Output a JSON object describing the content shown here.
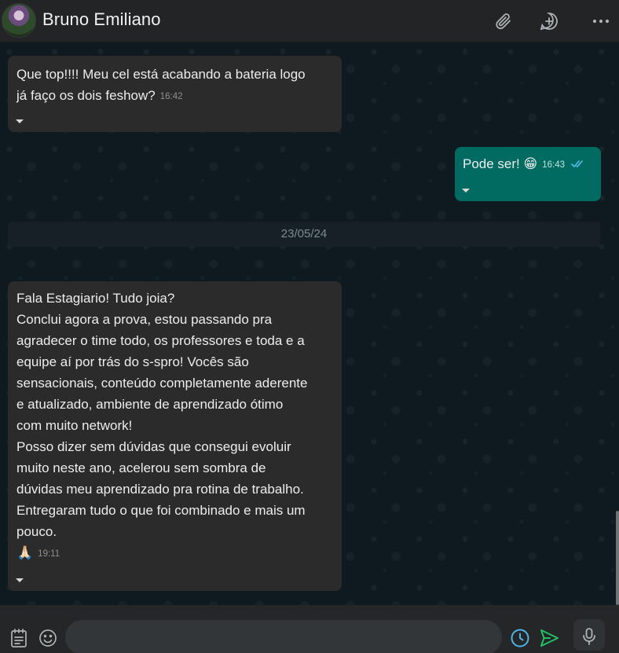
{
  "header": {
    "contact_name": "Bruno Emiliano",
    "icons": [
      "paperclip-icon",
      "new-chat-icon",
      "more-options-icon"
    ]
  },
  "messages": [
    {
      "direction": "incoming",
      "text": "Que top!!!! Meu cel está acabando a bateria logo\njá faço os dois feshow?",
      "time": "16:42"
    },
    {
      "direction": "outgoing",
      "text": "Pode ser! 😁",
      "time": "16:43",
      "status": "read"
    },
    {
      "direction": "incoming",
      "text": "Fala Estagiario! Tudo joia?\nConclui agora a prova, estou passando pra\nagradecer o time todo, os professores e toda e a\nequipe aí por trás do s-spro! Vocês são\nsensacionais, conteúdo completamente aderente\ne atualizado, ambiente de aprendizado ótimo\ncom muito network!\nPosso dizer sem dúvidas que consegui evoluir\nmuito neste ano, acelerou sem sombra de\ndúvidas meu aprendizado pra rotina de trabalho.\nEntregaram tudo o que foi combinado e mais um\npouco.\n🙏🏻",
      "time": "19:11"
    }
  ],
  "date_separator": "23/05/24",
  "composer": {
    "placeholder": "",
    "value": "",
    "icons": [
      "clipboard-icon",
      "emoji-icon",
      "schedule-clock-icon",
      "send-icon",
      "microphone-icon"
    ]
  },
  "colors": {
    "header_bg": "#222426",
    "incoming_bubble": "#2b2b2b",
    "outgoing_bubble": "#016b62",
    "read_ticks": "#53bdeb",
    "send_accent": "#21c063",
    "clock_accent": "#4fb3e8"
  }
}
